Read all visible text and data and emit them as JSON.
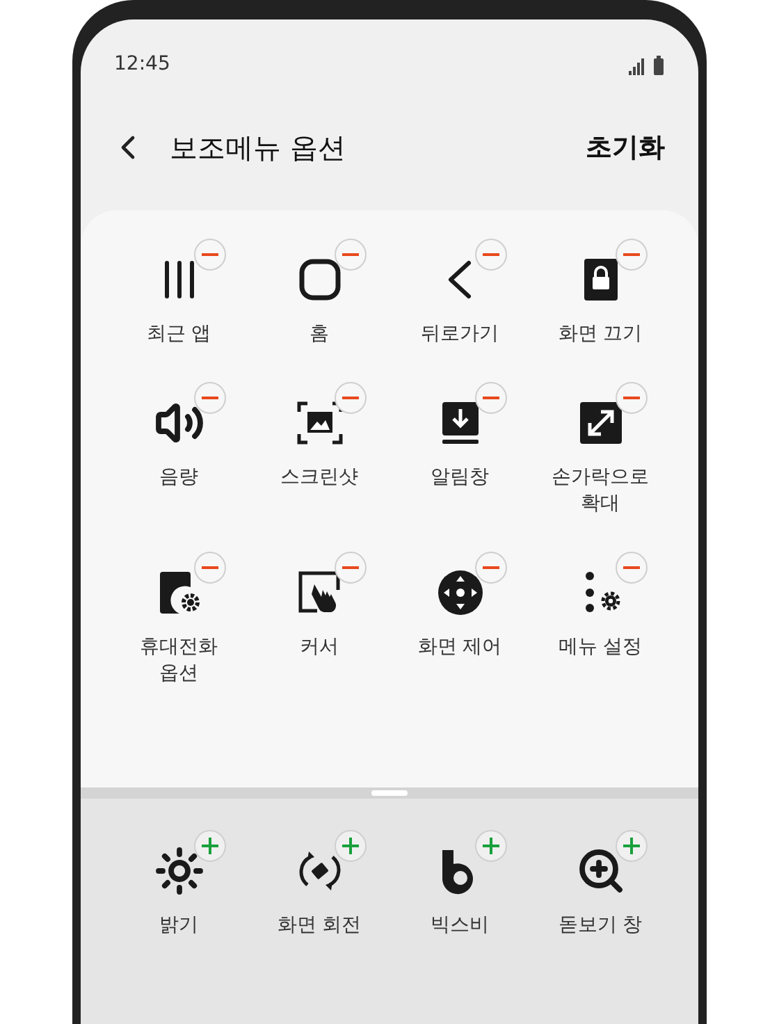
{
  "status_bar": {
    "time": "12:45"
  },
  "header": {
    "title": "보조메뉴 옵션",
    "action": "초기화"
  },
  "sections": [
    {
      "kind": "remove",
      "items": [
        {
          "label": "최근 앱",
          "kind": "recent"
        },
        {
          "label": "홈",
          "kind": "home"
        },
        {
          "label": "뒤로가기",
          "kind": "back"
        },
        {
          "label": "화면 끄기",
          "kind": "lock"
        },
        {
          "label": "음량",
          "kind": "volume"
        },
        {
          "label": "스크린샷",
          "kind": "screenshot"
        },
        {
          "label": "알림창",
          "kind": "notification"
        },
        {
          "label": "손가락으로 확대",
          "kind": "expand"
        },
        {
          "label": "휴대전화 옵션",
          "kind": "phone"
        },
        {
          "label": "커서",
          "kind": "cursor"
        },
        {
          "label": "화면 제어",
          "kind": "dpad"
        },
        {
          "label": "메뉴 설정",
          "kind": "menu"
        }
      ]
    },
    {
      "kind": "add",
      "items": [
        {
          "label": "밝기",
          "kind": "brightness"
        },
        {
          "label": "화면 회전",
          "kind": "rotate"
        },
        {
          "label": "빅스비",
          "kind": "bixby"
        },
        {
          "label": "돋보기 창",
          "kind": "magnifier"
        }
      ]
    }
  ]
}
